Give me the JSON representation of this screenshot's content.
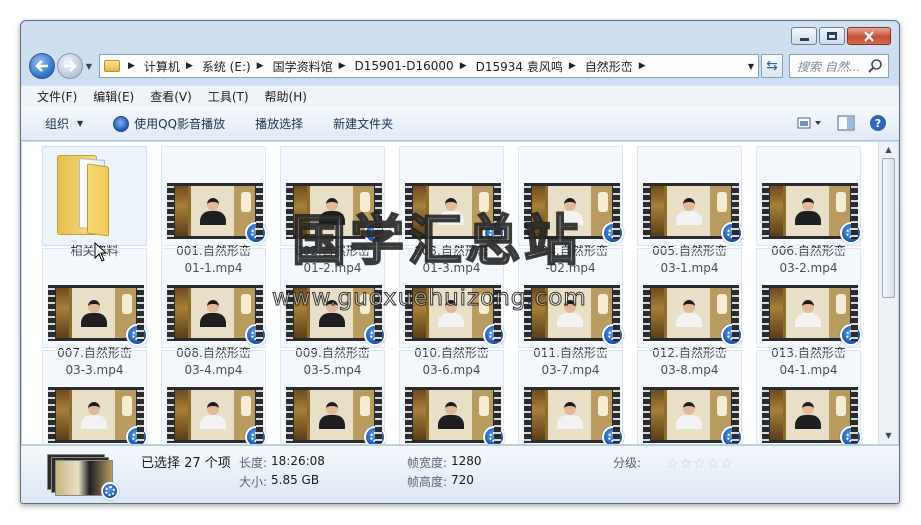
{
  "window": {
    "caption": {
      "minimize": "—",
      "maximize": "□",
      "close": "✕"
    }
  },
  "address": {
    "crumbs": [
      "计算机",
      "系统 (E:)",
      "国学资料馆",
      "D15901-D16000",
      "D15934 袁风鸣",
      "自然形峦"
    ],
    "search_placeholder": "搜索 自然..."
  },
  "menu": [
    "文件(F)",
    "编辑(E)",
    "查看(V)",
    "工具(T)",
    "帮助(H)"
  ],
  "commands": {
    "organize": "组织",
    "play_qq": "使用QQ影音播放",
    "play_selection": "播放选择",
    "new_folder": "新建文件夹"
  },
  "items": [
    {
      "type": "folder",
      "label": "相关资料"
    },
    {
      "type": "video",
      "label1": "001.自然形峦",
      "label2": "01-1.mp4",
      "shirt": "black"
    },
    {
      "type": "video",
      "label1": "002.自然形峦",
      "label2": "01-2.mp4",
      "shirt": "black"
    },
    {
      "type": "video",
      "label1": "003.自然形峦",
      "label2": "01-3.mp4",
      "shirt": "white"
    },
    {
      "type": "video",
      "label1": "004.自然形峦",
      "label2": "-02.mp4",
      "shirt": "white"
    },
    {
      "type": "video",
      "label1": "005.自然形峦",
      "label2": "03-1.mp4",
      "shirt": "white"
    },
    {
      "type": "video",
      "label1": "006.自然形峦",
      "label2": "03-2.mp4",
      "shirt": "black"
    },
    {
      "type": "video",
      "label1": "007.自然形峦",
      "label2": "03-3.mp4",
      "shirt": "black"
    },
    {
      "type": "video",
      "label1": "008.自然形峦",
      "label2": "03-4.mp4",
      "shirt": "black"
    },
    {
      "type": "video",
      "label1": "009.自然形峦",
      "label2": "03-5.mp4",
      "shirt": "black"
    },
    {
      "type": "video",
      "label1": "010.自然形峦",
      "label2": "03-6.mp4",
      "shirt": "white"
    },
    {
      "type": "video",
      "label1": "011.自然形峦",
      "label2": "03-7.mp4",
      "shirt": "white"
    },
    {
      "type": "video",
      "label1": "012.自然形峦",
      "label2": "03-8.mp4",
      "shirt": "white"
    },
    {
      "type": "video",
      "label1": "013.自然形峦",
      "label2": "04-1.mp4",
      "shirt": "white"
    },
    {
      "type": "video",
      "label1": "",
      "label2": "",
      "shirt": "white"
    },
    {
      "type": "video",
      "label1": "",
      "label2": "",
      "shirt": "white"
    },
    {
      "type": "video",
      "label1": "",
      "label2": "",
      "shirt": "black"
    },
    {
      "type": "video",
      "label1": "",
      "label2": "",
      "shirt": "black"
    },
    {
      "type": "video",
      "label1": "",
      "label2": "",
      "shirt": "white"
    },
    {
      "type": "video",
      "label1": "",
      "label2": "",
      "shirt": "white"
    },
    {
      "type": "video",
      "label1": "",
      "label2": "",
      "shirt": "black"
    }
  ],
  "watermark": {
    "text": "国学汇总站",
    "url": "www.guoxuehuizong.com"
  },
  "details": {
    "selected": "已选择 27 个项",
    "length_label": "长度:",
    "length_value": "18:26:08",
    "size_label": "大小:",
    "size_value": "5.85 GB",
    "width_label": "帧宽度:",
    "width_value": "1280",
    "height_label": "帧高度:",
    "height_value": "720",
    "rating_label": "分级:",
    "rating_stars": 0
  }
}
